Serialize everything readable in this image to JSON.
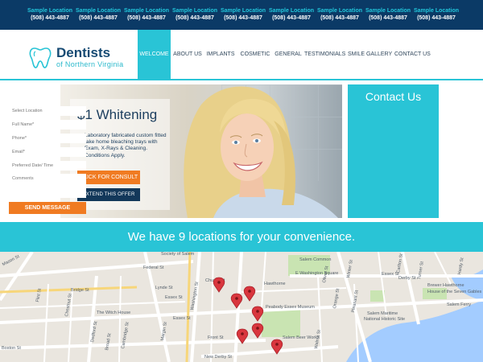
{
  "locations": [
    {
      "name": "Sample Location",
      "phone": "(508) 443-4887"
    },
    {
      "name": "Sample Location",
      "phone": "(508) 443-4887"
    },
    {
      "name": "Sample Location",
      "phone": "(508) 443-4887"
    },
    {
      "name": "Sample Location",
      "phone": "(508) 443-4887"
    },
    {
      "name": "Sample Location",
      "phone": "(508) 443-4887"
    },
    {
      "name": "Sample Location",
      "phone": "(508) 443-4887"
    },
    {
      "name": "Sample Location",
      "phone": "(508) 443-4887"
    },
    {
      "name": "Sample Location",
      "phone": "(508) 443-4887"
    },
    {
      "name": "Sample Location",
      "phone": "(508) 443-4887"
    }
  ],
  "logo": {
    "title": "Dentists",
    "subtitle": "of Northern Virginia",
    "icon": "tooth-icon"
  },
  "nav": [
    {
      "label": "WELCOME",
      "active": true
    },
    {
      "label": "ABOUT US"
    },
    {
      "label": "IMPLANTS"
    },
    {
      "label": "COSMETIC"
    },
    {
      "label": "GENERAL"
    },
    {
      "label": "TESTIMONIALS"
    },
    {
      "label": "SMILE GALLERY"
    },
    {
      "label": "CONTACT US"
    }
  ],
  "hero": {
    "title": "$1 Whitening",
    "check_icon": "checkmark-icon",
    "description": "Laboratory fabricated custom fitted take home bleaching trays with Exam, X-Rays & Cleaning. Conditions Apply.",
    "consult_label": "CLICK FOR CONSULT",
    "extend_label": "EXTEND THIS OFFER"
  },
  "contact": {
    "title": "Contact Us",
    "fields": [
      "Select Location",
      "Full Name*",
      "Phone*",
      "Email*",
      "Preferred Date/ Time"
    ],
    "comments_placeholder": "Comments",
    "send_label": "SEND MESSAGE"
  },
  "banner": {
    "text": "We have 9 locations for your convenience."
  },
  "map": {
    "labels": {
      "society_of_salem": "Society of Salem",
      "federal_st": "Federal St",
      "salem_common": "Salem Common",
      "washington_square": "E Washington Square",
      "hawthorne": "Hawthorne",
      "mason_st": "Mason St",
      "lynde_st": "Lynde St",
      "church_st": "Church St",
      "essex_st": "Essex St",
      "essex_st_2": "Essex St",
      "peabody_essex": "Peabody Essex Museum",
      "the_witch_house": "The Witch House",
      "bridge_st": "Bridge St",
      "boston_st": "Boston St",
      "front_st": "Front St",
      "salem_beer_works": "Salem Beer Works",
      "new_derby_st": "New Derby St",
      "derby_st": "Derby St",
      "brewer_hawthorne": "Brewer Hawthorne",
      "house_seven_gables": "House of the Seven Gables",
      "salem_ferry": "Salem Ferry",
      "salem_maritime": "Salem Maritime",
      "national_historic_site": "National Historic Site",
      "essex_st_right": "Essex St",
      "winter_st": "Winter St",
      "carlton_st": "Carlton St",
      "turner_st": "Turner St",
      "hardy_st": "Hardy St",
      "orange_st": "Orange St",
      "oliver_st": "Oliver St",
      "dedford_st": "Dedford St",
      "chestnut_st": "Chestnut St",
      "broad_st": "Broad St",
      "flint_st": "Flint St",
      "pleasant_st": "Pleasant St",
      "walnut_st": "Walnut St",
      "cambridge_st": "Cambridge St",
      "washington_st": "Washington St",
      "margin_st": "Margin St"
    },
    "pin_icon": "map-pin-icon",
    "pin_count": 7
  },
  "colors": {
    "navy": "#0b3a66",
    "teal": "#29c4d6",
    "orange": "#f07b22",
    "dark_navy": "#13385a"
  }
}
